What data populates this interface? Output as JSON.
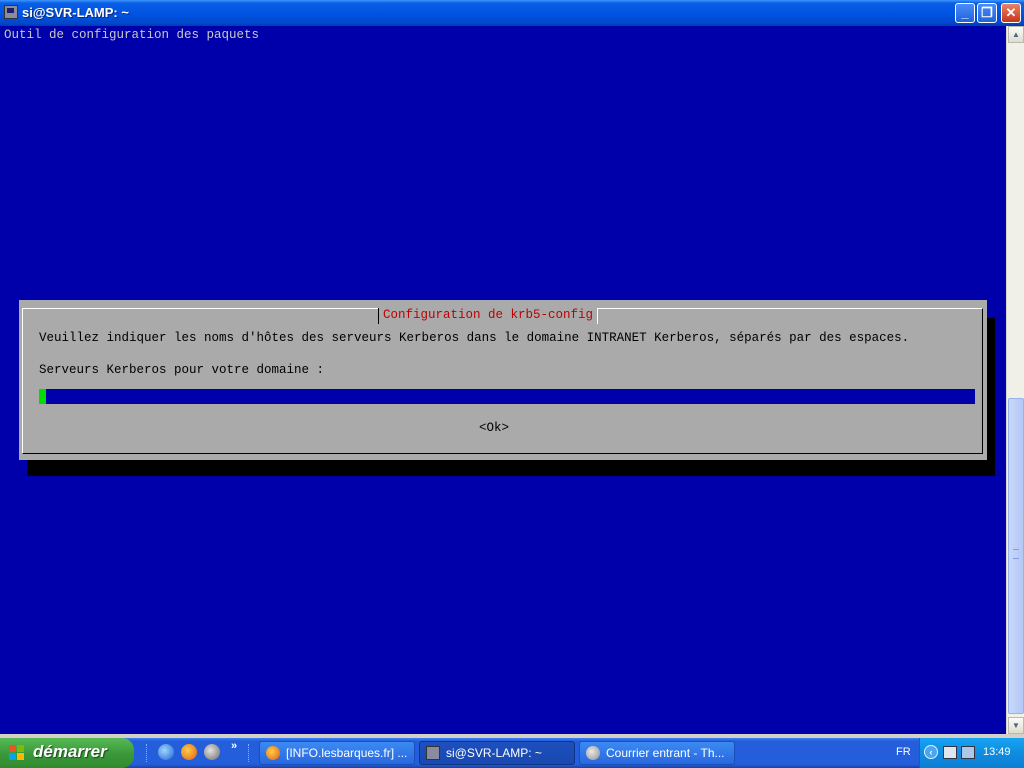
{
  "window": {
    "title": "si@SVR-LAMP: ~",
    "minimize": "_",
    "maximize": "❐",
    "close": "✕"
  },
  "terminal": {
    "header": "Outil de configuration des paquets",
    "dialog": {
      "title": "Configuration de krb5-config",
      "message": "Veuillez indiquer les noms d'hôtes des serveurs Kerberos dans le domaine INTRANET Kerberos, séparés par des espaces.",
      "field_label": "Serveurs Kerberos pour votre domaine :",
      "field_value": "",
      "ok_label": "<Ok>"
    }
  },
  "taskbar": {
    "start_label": "démarrer",
    "quicklaunch_more": "»",
    "tasks": [
      {
        "label": "[INFO.lesbarques.fr] ..."
      },
      {
        "label": "si@SVR-LAMP: ~"
      },
      {
        "label": "Courrier entrant - Th..."
      }
    ],
    "language": "FR",
    "clock": "13:49"
  },
  "colors": {
    "terminal_bg": "#0000aa",
    "dialog_bg": "#aaaaaa",
    "dialog_title": "#c00000",
    "cursor": "#00dd00"
  }
}
